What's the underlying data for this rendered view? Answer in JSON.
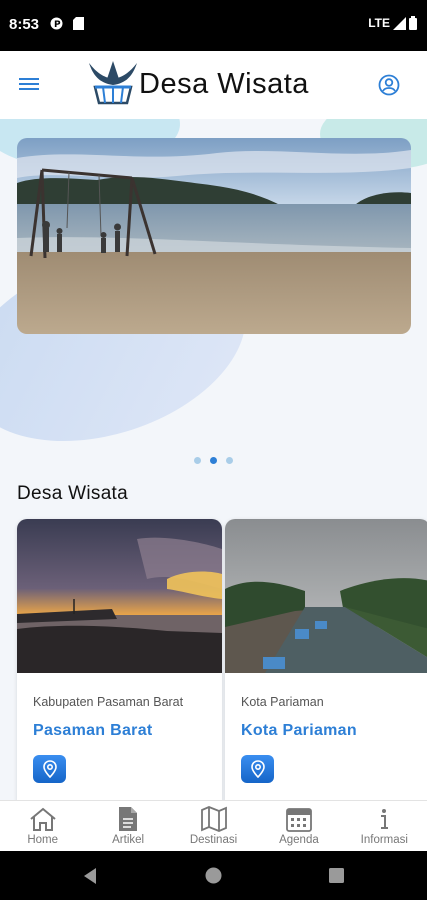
{
  "status_bar": {
    "time": "8:53",
    "network": "LTE"
  },
  "app_bar": {
    "title": "Desa Wisata"
  },
  "carousel": {
    "dot_count": 3,
    "active_dot": 1
  },
  "section": {
    "title": "Desa Wisata"
  },
  "cards": [
    {
      "region": "Kabupaten Pasaman Barat",
      "name": "Pasaman Barat"
    },
    {
      "region": "Kota Pariaman",
      "name": "Kota Pariaman"
    }
  ],
  "bottom_nav": [
    {
      "label": "Home",
      "icon": "home-icon"
    },
    {
      "label": "Artikel",
      "icon": "document-icon"
    },
    {
      "label": "Destinasi",
      "icon": "map-icon"
    },
    {
      "label": "Agenda",
      "icon": "calendar-icon"
    },
    {
      "label": "Informasi",
      "icon": "info-icon"
    }
  ],
  "colors": {
    "accent": "#2d7fd6",
    "status_bar": "#000000"
  }
}
